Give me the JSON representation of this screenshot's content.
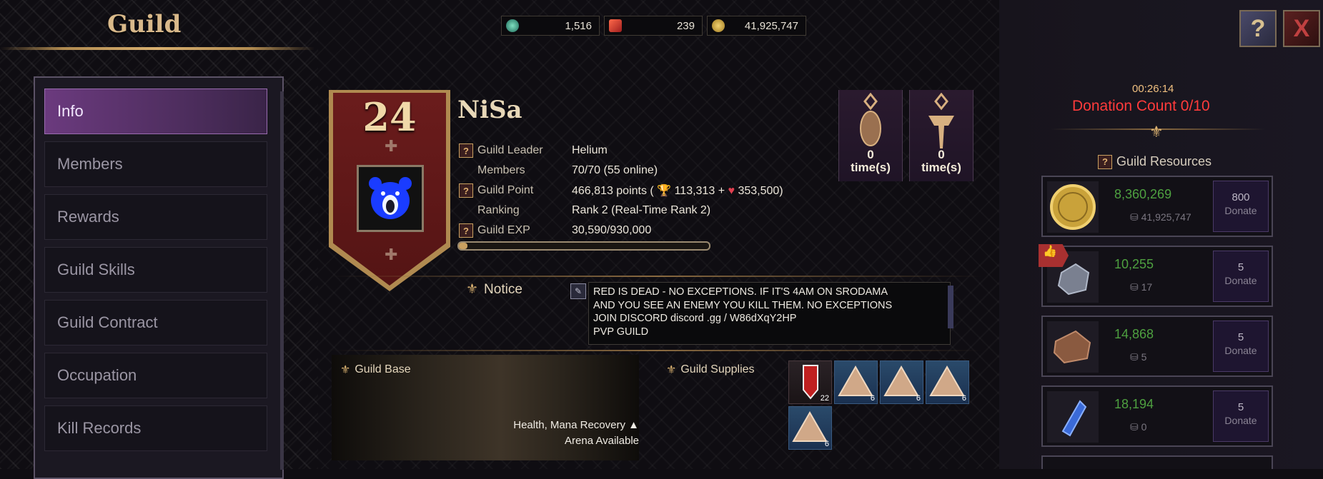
{
  "header": {
    "title": "Guild"
  },
  "menu": {
    "items": [
      {
        "label": "Info"
      },
      {
        "label": "Members"
      },
      {
        "label": "Rewards"
      },
      {
        "label": "Guild Skills"
      },
      {
        "label": "Guild Contract"
      },
      {
        "label": "Occupation"
      },
      {
        "label": "Kill Records"
      }
    ]
  },
  "currencies": [
    {
      "icon": "gem-icon",
      "value": "1,516"
    },
    {
      "icon": "ticket-icon",
      "value": "239"
    },
    {
      "icon": "gold-coin-icon",
      "value": "41,925,747"
    }
  ],
  "top_buttons": {
    "help_icon": "help-book-icon",
    "close_icon": "close-icon",
    "close_label": "X"
  },
  "guild": {
    "level": "24",
    "name": "NiSa",
    "rows": [
      {
        "label": "Guild Leader",
        "value": "Helium",
        "help": true
      },
      {
        "label": "Members",
        "value": "70/70 (55 online)",
        "help": false
      },
      {
        "label": "Guild Point",
        "value": "466,813 points (",
        "value_a": "113,313",
        "plus": " + ",
        "value_b": "353,500",
        "close": ")",
        "help": true
      },
      {
        "label": "Ranking",
        "value": "Rank 2 (Real-Time Rank 2)",
        "help": false
      },
      {
        "label": "Guild EXP",
        "value": "30,590/930,000",
        "help": true
      }
    ],
    "exp_progress": 0.033
  },
  "medals": [
    {
      "count": "0",
      "unit": "time(s)"
    },
    {
      "count": "0",
      "unit": "time(s)"
    }
  ],
  "notice": {
    "label": "Notice",
    "lines": [
      "RED IS DEAD - NO EXCEPTIONS. IF IT'S 4AM ON S",
      "RODAMA",
      "AND YOU SEE AN ENEMY YOU KILL THEM. NO EXCEPTIONS",
      "",
      "JOIN DISCORD discord .gg / W86dXqY2HP",
      "PVP GUILD"
    ]
  },
  "guild_base": {
    "label": "Guild Base",
    "line1": "Health, Mana Recovery ▲",
    "line2": "Arena Available"
  },
  "guild_supplies": {
    "label": "Guild Supplies",
    "items": [
      {
        "name": "red-flag-supply-icon",
        "count": "22"
      },
      {
        "name": "tent-supply-icon",
        "count": "6"
      },
      {
        "name": "tent-supply-icon",
        "count": "6"
      },
      {
        "name": "tent-supply-icon",
        "count": "6"
      },
      {
        "name": "tent-supply-icon",
        "count": "6"
      }
    ]
  },
  "donation": {
    "timer": "00:26:14",
    "count_text": "Donation Count  0/10"
  },
  "resources": {
    "title": "Guild Resources",
    "items": [
      {
        "icon": "gold-coin-icon",
        "amount": "8,360,269",
        "held": "41,925,747",
        "cost": "800",
        "button": "Donate"
      },
      {
        "icon": "ore-icon",
        "amount": "10,255",
        "held": "17",
        "cost": "5",
        "button": "Donate"
      },
      {
        "icon": "leather-icon",
        "amount": "14,868",
        "held": "5",
        "cost": "5",
        "button": "Donate"
      },
      {
        "icon": "crystal-icon",
        "amount": "18,194",
        "held": "0",
        "cost": "5",
        "button": "Donate"
      }
    ]
  },
  "colors": {
    "accent_gold": "#d9b98a",
    "donation_red": "#ff3b3b",
    "resource_green": "#4ea040",
    "menu_active": "#6b3a7e"
  }
}
